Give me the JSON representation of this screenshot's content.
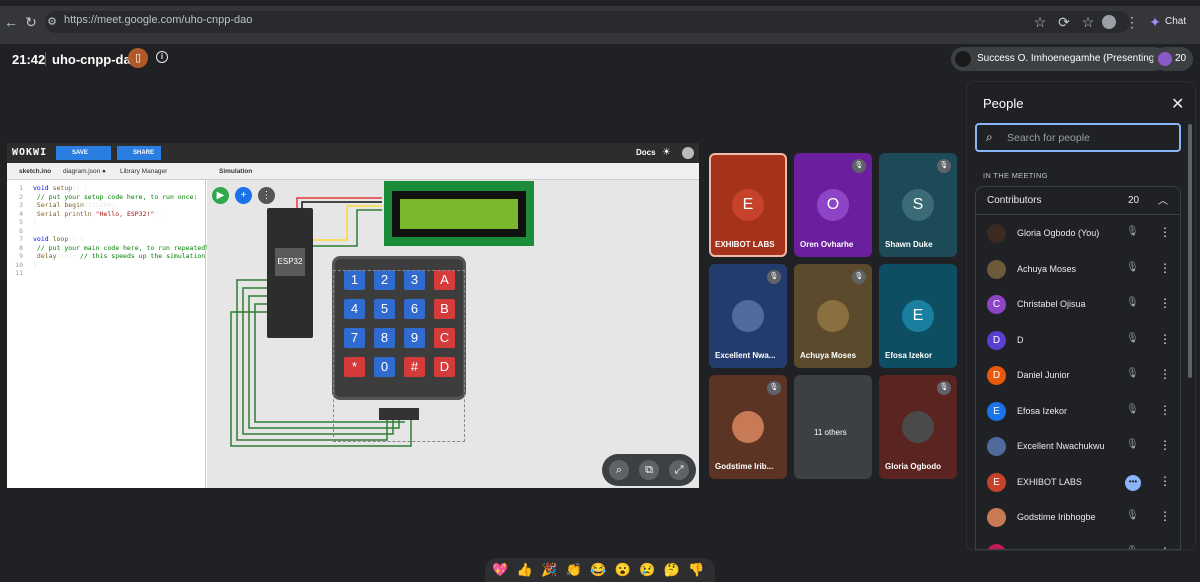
{
  "browser": {
    "url": "https://meet.google.com/uho-cnpp-dao",
    "chat_label": "Chat"
  },
  "meet": {
    "time": "21:42",
    "meeting_code": "uho-cnpp-dao",
    "presenter_chip": "Success O. Imhoenegamhe (Presenting)",
    "participant_count": "20"
  },
  "wokwi": {
    "logo": "WOKWI",
    "save_label": "SAVE",
    "share_label": "SHARE",
    "docs_label": "Docs",
    "tabs": [
      "sketch.ino",
      "diagram.json ●",
      "Library Manager"
    ],
    "sim_tab": "Simulation",
    "esp32_label": "ESP32",
    "code_lines": [
      {
        "n": "1",
        "html": "<span class=\"kw\">void</span> <span class=\"fn\">setup</span>() {"
      },
      {
        "n": "2",
        "html": "  <span class=\"cm\">// put your setup code here, to run once:</span>"
      },
      {
        "n": "3",
        "html": "  <span class=\"fn\">Serial</span>.<span class=\"fn\">begin</span>(115200);"
      },
      {
        "n": "4",
        "html": "  <span class=\"fn\">Serial</span>.<span class=\"fn\">println</span>(<span class=\"str\">\"Hello, ESP32!\"</span>);"
      },
      {
        "n": "5",
        "html": "}"
      },
      {
        "n": "6",
        "html": ""
      },
      {
        "n": "7",
        "html": "<span class=\"kw\">void</span> <span class=\"fn\">loop</span>() {"
      },
      {
        "n": "8",
        "html": "  <span class=\"cm\">// put your main code here, to run repeatedly:</span>"
      },
      {
        "n": "9",
        "html": "  <span class=\"fn\">delay</span>(10); <span class=\"cm\">// this speeds up the simulation</span>"
      },
      {
        "n": "10",
        "html": "}"
      },
      {
        "n": "11",
        "html": ""
      }
    ],
    "keys": [
      "1",
      "2",
      "3",
      "A",
      "4",
      "5",
      "6",
      "B",
      "7",
      "8",
      "9",
      "C",
      "*",
      "0",
      "#",
      "D"
    ]
  },
  "tiles": [
    {
      "name": "EXHIBOT LABS",
      "initial": "E",
      "bg": "#a5321b",
      "circle": "#c6422a",
      "muted": false,
      "active": true
    },
    {
      "name": "Oren Ovharhe",
      "initial": "O",
      "bg": "#6a1f9e",
      "circle": "#8e44c7",
      "muted": true
    },
    {
      "name": "Shawn Duke",
      "initial": "S",
      "bg": "#1d4a57",
      "circle": "#3c6b78",
      "muted": true
    },
    {
      "name": "Excellent Nwa...",
      "initial": "",
      "bg": "#243b6e",
      "circle": "#506a9c",
      "muted": true
    },
    {
      "name": "Achuya Moses",
      "initial": "",
      "bg": "#5b4a2c",
      "circle": "#8a7040",
      "muted": true
    },
    {
      "name": "Efosa Izekor",
      "initial": "E",
      "bg": "#0e4e63",
      "circle": "#1a7fa0",
      "muted": false
    },
    {
      "name": "Godstime Irib...",
      "initial": "",
      "bg": "#5b3424",
      "circle": "#c77a55",
      "muted": true
    },
    {
      "name": "11 others",
      "initial": "",
      "bg": "#3c4043",
      "circle": "#202124",
      "muted": false
    },
    {
      "name": "Gloria Ogbodo",
      "initial": "",
      "bg": "#5a2420",
      "circle": "#4a4a4a",
      "muted": true
    }
  ],
  "people_panel": {
    "title": "People",
    "search_placeholder": "Search for people",
    "section_label": "IN THE MEETING",
    "group_label": "Contributors",
    "group_count": "20",
    "people": [
      {
        "name": "Gloria Ogbodo (You)",
        "initial": "",
        "color": "#3a2a22",
        "speaking": false
      },
      {
        "name": "Achuya Moses",
        "initial": "",
        "color": "#6c5a3a",
        "speaking": false
      },
      {
        "name": "Christabel Ojisua",
        "initial": "C",
        "color": "#8e44c7",
        "speaking": false
      },
      {
        "name": "D",
        "initial": "D",
        "color": "#5a3fcf",
        "speaking": false
      },
      {
        "name": "Daniel Junior",
        "initial": "D",
        "color": "#e8590c",
        "speaking": false
      },
      {
        "name": "Efosa Izekor",
        "initial": "E",
        "color": "#1a73e8",
        "speaking": false
      },
      {
        "name": "Excellent Nwachukwu",
        "initial": "",
        "color": "#506a9c",
        "speaking": false
      },
      {
        "name": "EXHIBOT LABS",
        "initial": "E",
        "color": "#c6422a",
        "speaking": true
      },
      {
        "name": "Godstime Iribhogbe",
        "initial": "",
        "color": "#c77a55",
        "speaking": false
      },
      {
        "name": "",
        "initial": "",
        "color": "#c2185b",
        "speaking": false
      }
    ]
  },
  "reactions": [
    "💖",
    "👍",
    "🎉",
    "👏",
    "😂",
    "😮",
    "😢",
    "🤔",
    "👎"
  ]
}
